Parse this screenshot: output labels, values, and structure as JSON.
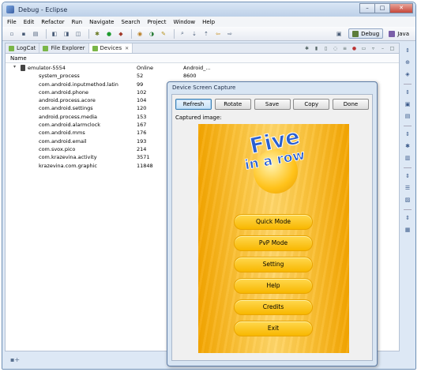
{
  "window": {
    "title": "Debug - Eclipse"
  },
  "menu": [
    "File",
    "Edit",
    "Refactor",
    "Run",
    "Navigate",
    "Search",
    "Project",
    "Window",
    "Help"
  ],
  "perspectives": {
    "debug": "Debug",
    "java": "Java"
  },
  "view_tabs": [
    {
      "label": "LogCat",
      "active": false
    },
    {
      "label": "File Explorer",
      "active": false
    },
    {
      "label": "Devices",
      "active": true
    }
  ],
  "devices": {
    "column_name": "Name",
    "emulator": {
      "name": "emulator-5554",
      "status": "Online",
      "target": "Android_..."
    },
    "processes": [
      {
        "name": "system_process",
        "pid": "52",
        "port": "8600"
      },
      {
        "name": "com.android.inputmethod.latin",
        "pid": "99",
        "port": ""
      },
      {
        "name": "com.android.phone",
        "pid": "102",
        "port": ""
      },
      {
        "name": "android.process.acore",
        "pid": "104",
        "port": ""
      },
      {
        "name": "com.android.settings",
        "pid": "120",
        "port": ""
      },
      {
        "name": "android.process.media",
        "pid": "153",
        "port": ""
      },
      {
        "name": "com.android.alarmclock",
        "pid": "167",
        "port": ""
      },
      {
        "name": "com.android.mms",
        "pid": "176",
        "port": ""
      },
      {
        "name": "com.android.email",
        "pid": "193",
        "port": ""
      },
      {
        "name": "com.svox.pico",
        "pid": "214",
        "port": ""
      },
      {
        "name": "com.krazevina.activity",
        "pid": "3571",
        "port": ""
      },
      {
        "name": "krazevina.com.graphic",
        "pid": "11848",
        "port": ""
      }
    ]
  },
  "dialog": {
    "title": "Device Screen Capture",
    "buttons": {
      "refresh": "Refresh",
      "rotate": "Rotate",
      "save": "Save",
      "copy": "Copy",
      "done": "Done"
    },
    "captured_label": "Captured image:",
    "game": {
      "logo_line1": "Five",
      "logo_line2": "in a row",
      "menu": [
        "Quick Mode",
        "PvP Mode",
        "Setting",
        "Help",
        "Credits",
        "Exit"
      ]
    }
  }
}
